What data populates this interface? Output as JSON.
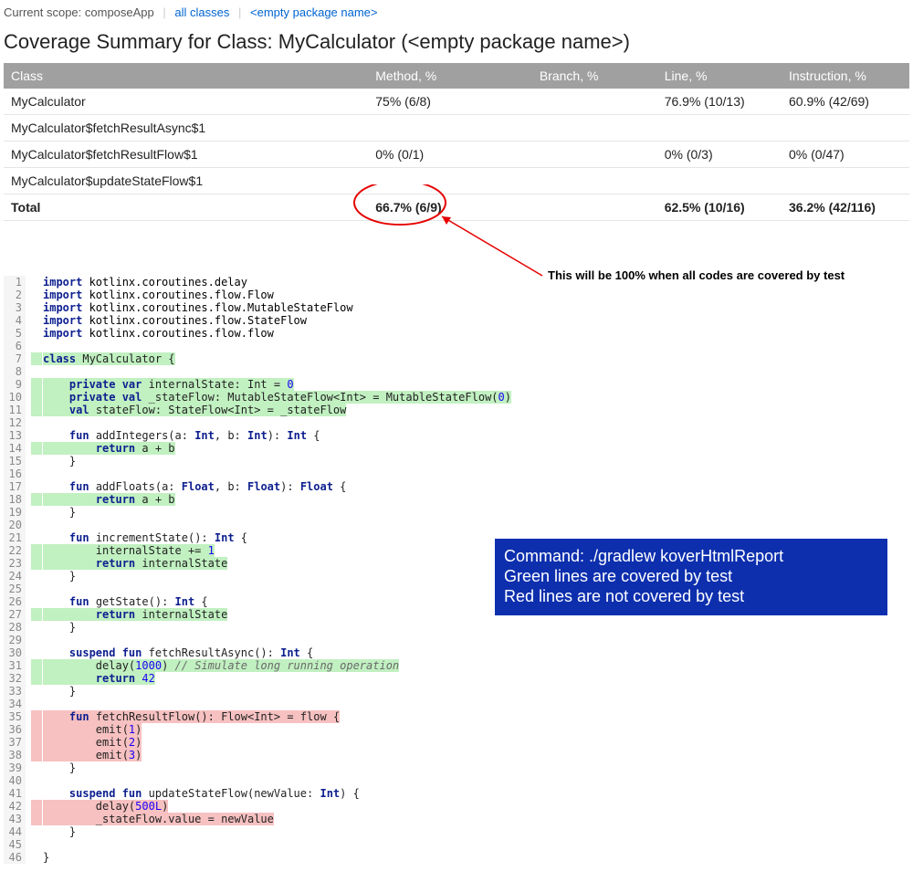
{
  "breadcrumb": {
    "scope_label": "Current scope:",
    "scope_value": "composeApp",
    "link_all": "all classes",
    "link_pkg": "<empty package name>"
  },
  "title": "Coverage Summary for Class: MyCalculator (<empty package name>)",
  "columns": {
    "class": "Class",
    "method": "Method, %",
    "branch": "Branch, %",
    "line": "Line, %",
    "instruction": "Instruction, %"
  },
  "rows": [
    {
      "class_": "MyCalculator",
      "method": "75% (6/8)",
      "branch": "",
      "line": "76.9% (10/13)",
      "instr": "60.9% (42/69)"
    },
    {
      "class_": "MyCalculator$fetchResultAsync$1",
      "method": "",
      "branch": "",
      "line": "",
      "instr": ""
    },
    {
      "class_": "MyCalculator$fetchResultFlow$1",
      "method": "0% (0/1)",
      "branch": "",
      "line": "0% (0/3)",
      "instr": "0% (0/47)"
    },
    {
      "class_": "MyCalculator$updateStateFlow$1",
      "method": "",
      "branch": "",
      "line": "",
      "instr": ""
    }
  ],
  "total": {
    "label": "Total",
    "method": "66.7% (6/9)",
    "branch": "",
    "line": "62.5% (10/16)",
    "instr": "36.2% (42/116)"
  },
  "annotation": "This will be 100% when all codes are covered by test",
  "legend": {
    "cmd": "Command: ./gradlew koverHtmlReport",
    "green": "Green lines are covered by test",
    "red": "Red lines are not covered by test"
  },
  "code": [
    {
      "n": 1,
      "g": "",
      "hl": "",
      "seg": [
        [
          "kw",
          "import"
        ],
        [
          "ty",
          " kotlinx.coroutines.delay"
        ]
      ]
    },
    {
      "n": 2,
      "g": "",
      "hl": "",
      "seg": [
        [
          "kw",
          "import"
        ],
        [
          "ty",
          " kotlinx.coroutines.flow.Flow"
        ]
      ]
    },
    {
      "n": 3,
      "g": "",
      "hl": "",
      "seg": [
        [
          "kw",
          "import"
        ],
        [
          "ty",
          " kotlinx.coroutines.flow.MutableStateFlow"
        ]
      ]
    },
    {
      "n": 4,
      "g": "",
      "hl": "",
      "seg": [
        [
          "kw",
          "import"
        ],
        [
          "ty",
          " kotlinx.coroutines.flow.StateFlow"
        ]
      ]
    },
    {
      "n": 5,
      "g": "",
      "hl": "",
      "seg": [
        [
          "kw",
          "import"
        ],
        [
          "ty",
          " kotlinx.coroutines.flow.flow"
        ]
      ]
    },
    {
      "n": 6,
      "g": "",
      "hl": "",
      "seg": [
        [
          "",
          ""
        ]
      ]
    },
    {
      "n": 7,
      "g": "gf",
      "hl": "hl-g",
      "seg": [
        [
          "kw",
          "class"
        ],
        [
          "",
          " MyCalculator {"
        ]
      ]
    },
    {
      "n": 8,
      "g": "",
      "hl": "",
      "seg": [
        [
          "",
          ""
        ]
      ]
    },
    {
      "n": 9,
      "g": "gf",
      "hl": "hl-g",
      "seg": [
        [
          "",
          "    "
        ],
        [
          "kw",
          "private var"
        ],
        [
          "",
          " internalState: Int = "
        ],
        [
          "num",
          "0"
        ]
      ]
    },
    {
      "n": 10,
      "g": "gf",
      "hl": "hl-g",
      "seg": [
        [
          "",
          "    "
        ],
        [
          "kw",
          "private val"
        ],
        [
          "",
          " _stateFlow: MutableStateFlow<Int> = MutableStateFlow("
        ],
        [
          "num",
          "0"
        ],
        [
          "",
          ")"
        ]
      ]
    },
    {
      "n": 11,
      "g": "gf",
      "hl": "hl-g",
      "seg": [
        [
          "",
          "    "
        ],
        [
          "kw",
          "val"
        ],
        [
          "",
          " stateFlow: StateFlow<Int> = _stateFlow"
        ]
      ]
    },
    {
      "n": 12,
      "g": "",
      "hl": "",
      "seg": [
        [
          "",
          ""
        ]
      ]
    },
    {
      "n": 13,
      "g": "",
      "hl": "",
      "seg": [
        [
          "",
          "    "
        ],
        [
          "kw",
          "fun"
        ],
        [
          "",
          " addIntegers(a: "
        ],
        [
          "kw",
          "Int"
        ],
        [
          "",
          ", b: "
        ],
        [
          "kw",
          "Int"
        ],
        [
          "",
          ")"
        ],
        [
          "",
          ": "
        ],
        [
          "kw",
          "Int"
        ],
        [
          "",
          " {"
        ]
      ]
    },
    {
      "n": 14,
      "g": "gf",
      "hl": "hl-g",
      "seg": [
        [
          "",
          "        "
        ],
        [
          "kw",
          "return"
        ],
        [
          "",
          " a + b"
        ]
      ]
    },
    {
      "n": 15,
      "g": "",
      "hl": "",
      "seg": [
        [
          "",
          "    }"
        ]
      ]
    },
    {
      "n": 16,
      "g": "",
      "hl": "",
      "seg": [
        [
          "",
          ""
        ]
      ]
    },
    {
      "n": 17,
      "g": "",
      "hl": "",
      "seg": [
        [
          "",
          "    "
        ],
        [
          "kw",
          "fun"
        ],
        [
          "",
          " addFloats(a: "
        ],
        [
          "kw",
          "Float"
        ],
        [
          "",
          ", b: "
        ],
        [
          "kw",
          "Float"
        ],
        [
          "",
          ")"
        ],
        [
          "",
          ": "
        ],
        [
          "kw",
          "Float"
        ],
        [
          "",
          " {"
        ]
      ]
    },
    {
      "n": 18,
      "g": "gf",
      "hl": "hl-g",
      "seg": [
        [
          "",
          "        "
        ],
        [
          "kw",
          "return"
        ],
        [
          "",
          " a + b"
        ]
      ]
    },
    {
      "n": 19,
      "g": "",
      "hl": "",
      "seg": [
        [
          "",
          "    }"
        ]
      ]
    },
    {
      "n": 20,
      "g": "",
      "hl": "",
      "seg": [
        [
          "",
          ""
        ]
      ]
    },
    {
      "n": 21,
      "g": "",
      "hl": "",
      "seg": [
        [
          "",
          "    "
        ],
        [
          "kw",
          "fun"
        ],
        [
          "",
          " incrementState(): "
        ],
        [
          "kw",
          "Int"
        ],
        [
          "",
          " {"
        ]
      ]
    },
    {
      "n": 22,
      "g": "gf",
      "hl": "hl-g",
      "seg": [
        [
          "",
          "        internalState += "
        ],
        [
          "num",
          "1"
        ]
      ]
    },
    {
      "n": 23,
      "g": "gf",
      "hl": "hl-g",
      "seg": [
        [
          "",
          "        "
        ],
        [
          "kw",
          "return"
        ],
        [
          "",
          " internalState"
        ]
      ]
    },
    {
      "n": 24,
      "g": "",
      "hl": "",
      "seg": [
        [
          "",
          "    }"
        ]
      ]
    },
    {
      "n": 25,
      "g": "",
      "hl": "",
      "seg": [
        [
          "",
          ""
        ]
      ]
    },
    {
      "n": 26,
      "g": "",
      "hl": "",
      "seg": [
        [
          "",
          "    "
        ],
        [
          "kw",
          "fun"
        ],
        [
          "",
          " getState(): "
        ],
        [
          "kw",
          "Int"
        ],
        [
          "",
          " {"
        ]
      ]
    },
    {
      "n": 27,
      "g": "gf",
      "hl": "hl-g",
      "seg": [
        [
          "",
          "        "
        ],
        [
          "kw",
          "return"
        ],
        [
          "",
          " internalState"
        ]
      ]
    },
    {
      "n": 28,
      "g": "",
      "hl": "",
      "seg": [
        [
          "",
          "    }"
        ]
      ]
    },
    {
      "n": 29,
      "g": "",
      "hl": "",
      "seg": [
        [
          "",
          ""
        ]
      ]
    },
    {
      "n": 30,
      "g": "",
      "hl": "",
      "seg": [
        [
          "",
          "    "
        ],
        [
          "kw",
          "suspend fun"
        ],
        [
          "",
          " fetchResultAsync(): "
        ],
        [
          "kw",
          "Int"
        ],
        [
          "",
          " {"
        ]
      ]
    },
    {
      "n": 31,
      "g": "gf",
      "hl": "hl-g",
      "seg": [
        [
          "",
          "        delay("
        ],
        [
          "num",
          "1000"
        ],
        [
          "",
          ") "
        ],
        [
          "cm",
          "// Simulate long running operation"
        ]
      ]
    },
    {
      "n": 32,
      "g": "gf",
      "hl": "hl-g",
      "seg": [
        [
          "",
          "        "
        ],
        [
          "kw",
          "return"
        ],
        [
          "",
          " "
        ],
        [
          "num",
          "42"
        ]
      ]
    },
    {
      "n": 33,
      "g": "",
      "hl": "",
      "seg": [
        [
          "",
          "    }"
        ]
      ]
    },
    {
      "n": 34,
      "g": "",
      "hl": "",
      "seg": [
        [
          "",
          ""
        ]
      ]
    },
    {
      "n": 35,
      "g": "gr",
      "hl": "hl-r",
      "seg": [
        [
          "",
          "    "
        ],
        [
          "kw",
          "fun"
        ],
        [
          "",
          " fetchResultFlow(): Flow<Int> = flow {"
        ]
      ]
    },
    {
      "n": 36,
      "g": "gr",
      "hl": "hl-r",
      "seg": [
        [
          "",
          "        emit("
        ],
        [
          "num",
          "1"
        ],
        [
          "",
          ")"
        ]
      ]
    },
    {
      "n": 37,
      "g": "gr",
      "hl": "hl-r",
      "seg": [
        [
          "",
          "        emit("
        ],
        [
          "num",
          "2"
        ],
        [
          "",
          ")"
        ]
      ]
    },
    {
      "n": 38,
      "g": "gr",
      "hl": "hl-r",
      "seg": [
        [
          "",
          "        emit("
        ],
        [
          "num",
          "3"
        ],
        [
          "",
          ")"
        ]
      ]
    },
    {
      "n": 39,
      "g": "",
      "hl": "",
      "seg": [
        [
          "",
          "    }"
        ]
      ]
    },
    {
      "n": 40,
      "g": "",
      "hl": "",
      "seg": [
        [
          "",
          ""
        ]
      ]
    },
    {
      "n": 41,
      "g": "",
      "hl": "",
      "seg": [
        [
          "",
          "    "
        ],
        [
          "kw",
          "suspend fun"
        ],
        [
          "",
          " updateStateFlow(newValue: "
        ],
        [
          "kw",
          "Int"
        ],
        [
          "",
          ") {"
        ]
      ]
    },
    {
      "n": 42,
      "g": "gr",
      "hl": "hl-r",
      "seg": [
        [
          "",
          "        delay("
        ],
        [
          "num",
          "500L"
        ],
        [
          "",
          ")"
        ]
      ]
    },
    {
      "n": 43,
      "g": "gr",
      "hl": "hl-r",
      "seg": [
        [
          "",
          "        _stateFlow.value = newValue"
        ]
      ]
    },
    {
      "n": 44,
      "g": "",
      "hl": "",
      "seg": [
        [
          "",
          "    }"
        ]
      ]
    },
    {
      "n": 45,
      "g": "",
      "hl": "",
      "seg": [
        [
          "",
          ""
        ]
      ]
    },
    {
      "n": 46,
      "g": "",
      "hl": "",
      "seg": [
        [
          "",
          "}"
        ]
      ]
    }
  ]
}
